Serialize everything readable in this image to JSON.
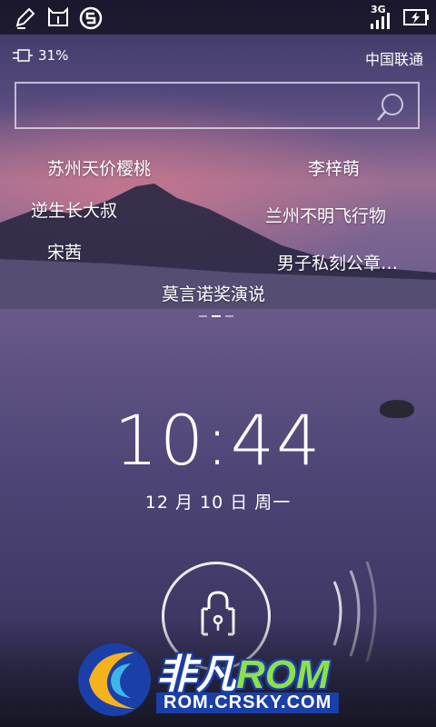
{
  "status_bar": {
    "network": "3G",
    "icons": [
      "edit-icon",
      "cat-icon",
      "s-logo-icon",
      "signal-icon",
      "battery-charging-icon"
    ]
  },
  "battery": {
    "percent_text": "31%"
  },
  "carrier": "中国联通",
  "search": {
    "placeholder": ""
  },
  "keywords": [
    "苏州天价樱桃",
    "李梓萌",
    "逆生长大叔",
    "兰州不明飞行物",
    "宋茜",
    "男子私刻公章…",
    "莫言诺奖演说"
  ],
  "pager": {
    "pages": 3,
    "active": 1
  },
  "clock": {
    "time": "10:44",
    "date": "12 月 10 日 周一"
  },
  "unlock": {
    "icon": "lock-icon"
  },
  "watermark": {
    "brand_cn": "非凡",
    "brand_rom": "ROM",
    "url": "ROM.CRSKY.COM"
  }
}
